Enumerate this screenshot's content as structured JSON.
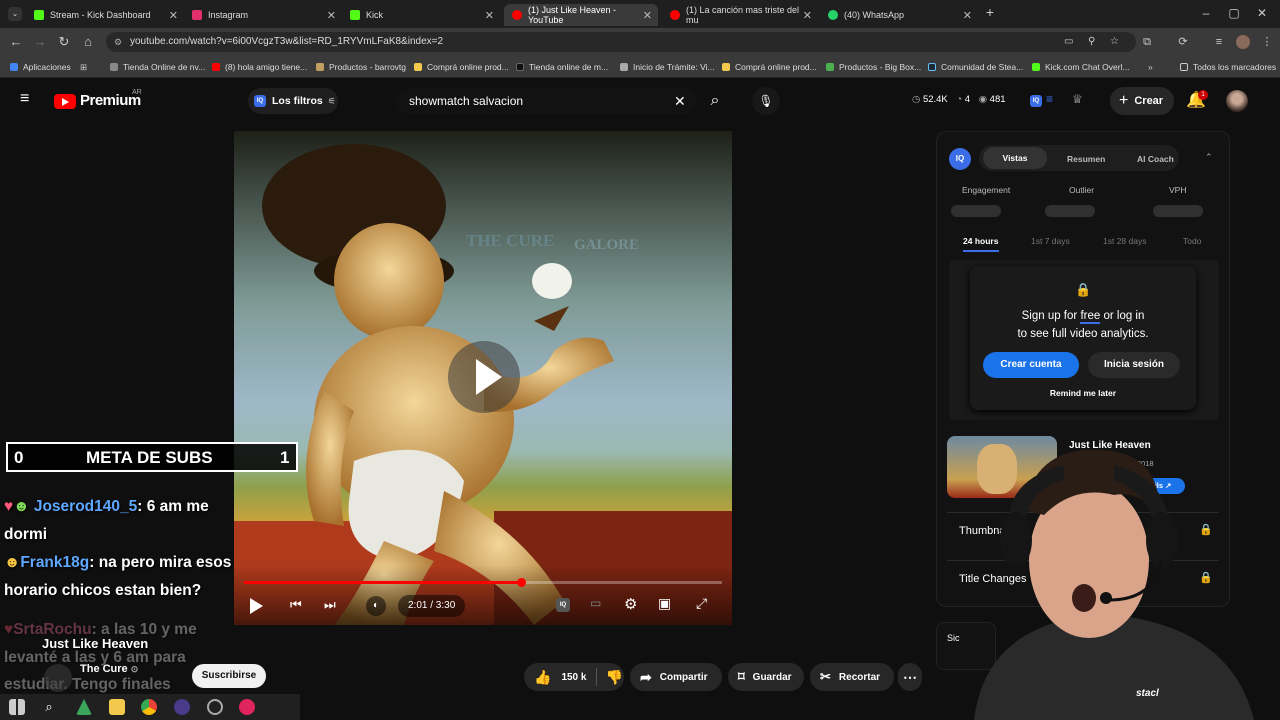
{
  "tabs": [
    {
      "label": "Stream - Kick Dashboard",
      "color": "#53fc18",
      "active": false
    },
    {
      "label": "Instagram",
      "color": "#e1306c",
      "active": false
    },
    {
      "label": "Kick",
      "color": "#53fc18",
      "active": false
    },
    {
      "label": "(1) Just Like Heaven - YouTube",
      "color": "#ff0000",
      "active": true
    },
    {
      "label": "(1) La canción mas triste del mu",
      "color": "#ff0000",
      "active": false
    },
    {
      "label": "(40) WhatsApp",
      "color": "#25d366",
      "active": false
    }
  ],
  "address": {
    "url": "youtube.com/watch?v=6i00VcgzT3w&list=RD_1RYVmLFaK8&index=2"
  },
  "bookmarks": [
    {
      "label": "Aplicaciones",
      "color": "#4285f4"
    },
    {
      "label": "Tienda Online de nv...",
      "color": "#888888"
    },
    {
      "label": "(8) hola amigo tiene...",
      "color": "#ff0000"
    },
    {
      "label": "Productos - barrovtg",
      "color": "#c0a060"
    },
    {
      "label": "Comprá online prod...",
      "color": "#f2c94c"
    },
    {
      "label": "Tienda online de m...",
      "color": "#111111"
    },
    {
      "label": "Inicio de Trámite: Vi...",
      "color": "#aaaaaa"
    },
    {
      "label": "Comprá online prod...",
      "color": "#f2c94c"
    },
    {
      "label": "Productos - Big Box...",
      "color": "#4caf50"
    },
    {
      "label": "Comunidad de Stea...",
      "color": "#1b2838"
    },
    {
      "label": "Kick.com Chat Overl...",
      "color": "#53fc18"
    }
  ],
  "bookmarks_all": "Todos los marcadores",
  "youtube": {
    "logo_text": "Premium",
    "logo_region": "AR",
    "filters_label": "Los filtros",
    "search_value": "showmatch salvacion",
    "stats": {
      "views": "52.4K",
      "likes": "4",
      "viewers": "481"
    },
    "create_label": "Crear",
    "notif_count": "1"
  },
  "overlay": {
    "meta_left": "0",
    "meta_label": "META DE SUBS",
    "meta_right": "1",
    "chat": [
      {
        "user": "Joserod140_5",
        "text": "6 am me",
        "cont": "dormi"
      },
      {
        "user": "Frank18g",
        "text": "na pero mira esos",
        "cont": "horario chicos estan bien?"
      },
      {
        "user": "SrtaRochu",
        "text": "a las 10 y me",
        "cont": "levanté a las y 6 am para",
        "cont2": "estudiar. Tengo finales"
      }
    ]
  },
  "video": {
    "album_text": "THE CURE",
    "album_sub": "GALORE",
    "time": "2:01 / 3:30",
    "progress": 0.58,
    "title": "Just Like Heaven",
    "channel": "The Cure",
    "subscribe_label": "Suscribirse",
    "likes": "150 k",
    "share_label": "Compartir",
    "save_label": "Guardar",
    "clip_label": "Recortar"
  },
  "panel": {
    "tabs": [
      "Vistas",
      "Resumen",
      "AI Coach"
    ],
    "metrics": [
      "Engagement",
      "Outlier",
      "VPH"
    ],
    "ranges": [
      "24 hours",
      "1st 7 days",
      "1st 28 days",
      "Todo"
    ],
    "promo_line1_pre": "Sign up for",
    "promo_free": "free",
    "promo_line1_post": "or log in",
    "promo_line2": "to see full video analytics.",
    "create_account": "Crear cuenta",
    "login": "Inicia sesión",
    "remind": "Remind me later",
    "rec_title": "Just Like Heaven",
    "rec_date": "11/2018",
    "rec_badge": "ails",
    "row1": "Thumbnai",
    "row2": "Title Changes",
    "side_cut": "Sic"
  },
  "webcam_brand": "stacl"
}
